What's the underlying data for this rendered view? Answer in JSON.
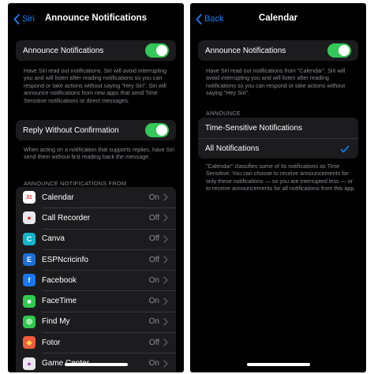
{
  "left": {
    "nav": {
      "back_label": "Siri",
      "title": "Announce Notifications"
    },
    "announce_row": {
      "label": "Announce Notifications",
      "on": true
    },
    "announce_footnote": "Have Siri read out notifications. Siri will avoid interrupting you and will listen after reading notifications so you can respond or take actions without saying \"Hey Siri\". Siri will announce notifications from new apps that send Time Sensitive notifications or direct messages.",
    "reply_row": {
      "label": "Reply Without Confirmation",
      "on": true
    },
    "reply_footnote": "When acting on a notification that supports replies, have Siri send them without first reading back the message.",
    "apps_header": "ANNOUNCE NOTIFICATIONS FROM",
    "apps": [
      {
        "name": "Calendar",
        "status": "On",
        "icon": "calendar-icon",
        "color": "#ffffff"
      },
      {
        "name": "Call Recorder",
        "status": "Off",
        "icon": "call-recorder-icon",
        "color": "#e8e8ee"
      },
      {
        "name": "Canva",
        "status": "Off",
        "icon": "canva-icon",
        "color": "#12b5cb"
      },
      {
        "name": "ESPNcricinfo",
        "status": "Off",
        "icon": "espncricinfo-icon",
        "color": "#1d6fd8"
      },
      {
        "name": "Facebook",
        "status": "On",
        "icon": "facebook-icon",
        "color": "#1877f2"
      },
      {
        "name": "FaceTime",
        "status": "On",
        "icon": "facetime-icon",
        "color": "#30c94e"
      },
      {
        "name": "Find My",
        "status": "On",
        "icon": "find-my-icon",
        "color": "#30c94e"
      },
      {
        "name": "Fotor",
        "status": "Off",
        "icon": "fotor-icon",
        "color": "#f25c3c"
      },
      {
        "name": "Game Center",
        "status": "On",
        "icon": "game-center-icon",
        "color": "#e8e8ee"
      }
    ]
  },
  "right": {
    "nav": {
      "back_label": "Back",
      "title": "Calendar"
    },
    "announce_row": {
      "label": "Announce Notifications",
      "on": true
    },
    "announce_footnote": "Have Siri read out notifications from \"Calendar\". Siri will avoid interrupting you and will listen after reading notifications so you can respond or take actions without saying \"Hey Siri\".",
    "section_header": "ANNOUNCE",
    "options": [
      {
        "label": "Time-Sensitive Notifications",
        "selected": false
      },
      {
        "label": "All Notifications",
        "selected": true
      }
    ],
    "options_footnote": "\"Calendar\" classifies some of its notifications as Time Sensitive. You can choose to receive announcements for only these notifications — so you are interrupted less — or to receive announcements for all notifications from this app."
  },
  "colors": {
    "accent": "#0a84ff",
    "toggle_on": "#34c759",
    "background": "#000000",
    "cell": "#1c1c1e",
    "secondary_text": "#8e8e93"
  }
}
